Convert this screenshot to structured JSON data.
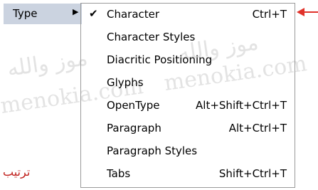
{
  "watermark": {
    "arabic_text": "موز والله",
    "latin_text": "menokia.com"
  },
  "parent_menu": {
    "label": "Type",
    "arrow_icon": "triangle-right-icon"
  },
  "submenu": {
    "items": [
      {
        "label": "Character",
        "shortcut": "Ctrl+T",
        "checked": true
      },
      {
        "label": "Character Styles",
        "shortcut": ""
      },
      {
        "label": "Diacritic Positioning",
        "shortcut": ""
      },
      {
        "label": "Glyphs",
        "shortcut": ""
      },
      {
        "label": "OpenType",
        "shortcut": "Alt+Shift+Ctrl+T"
      },
      {
        "label": "Paragraph",
        "shortcut": "Alt+Ctrl+T"
      },
      {
        "label": "Paragraph Styles",
        "shortcut": ""
      },
      {
        "label": "Tabs",
        "shortcut": "Shift+Ctrl+T"
      }
    ]
  },
  "annotation": {
    "caption": "ترتيب",
    "arrow_icon": "red-arrow-icon",
    "color": "#c0201c"
  }
}
